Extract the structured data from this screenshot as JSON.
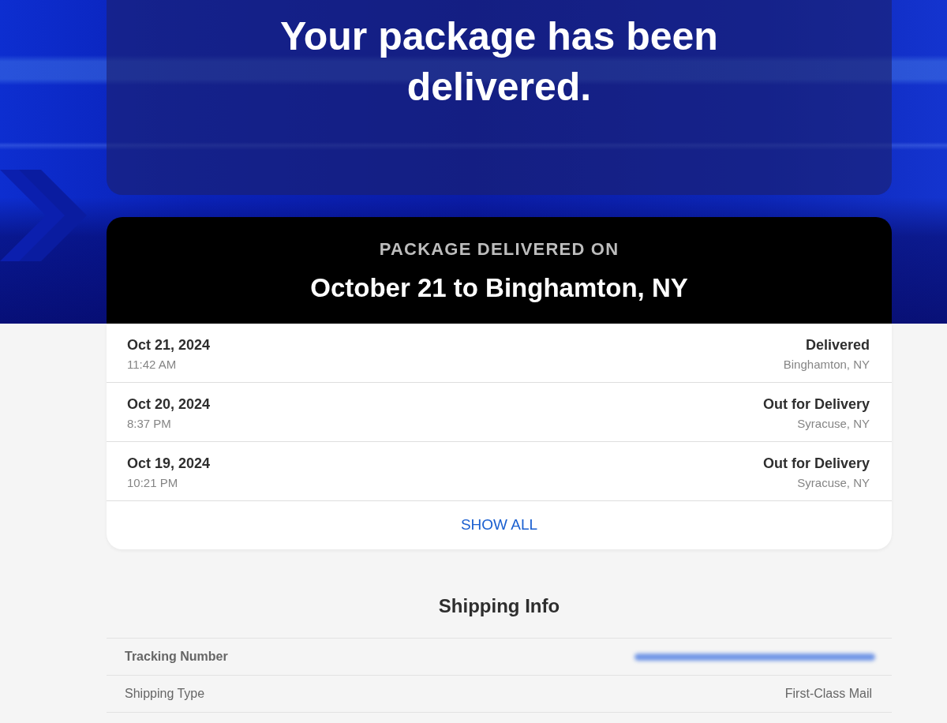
{
  "hero": {
    "headline": "Your package has been delivered."
  },
  "delivery_summary": {
    "label": "PACKAGE DELIVERED ON",
    "detail": "October 21 to Binghamton, NY"
  },
  "tracking_events": [
    {
      "date": "Oct 21, 2024",
      "time": "11:42 AM",
      "status": "Delivered",
      "location": "Binghamton, NY"
    },
    {
      "date": "Oct 20, 2024",
      "time": "8:37 PM",
      "status": "Out for Delivery",
      "location": "Syracuse, NY"
    },
    {
      "date": "Oct 19, 2024",
      "time": "10:21 PM",
      "status": "Out for Delivery",
      "location": "Syracuse, NY"
    }
  ],
  "show_all": "SHOW ALL",
  "shipping_info": {
    "title": "Shipping Info",
    "rows": [
      {
        "kind": "redacted",
        "label": "Tracking Number"
      },
      {
        "kind": "text",
        "label": "Shipping Type",
        "value": "First-Class Mail"
      }
    ]
  }
}
